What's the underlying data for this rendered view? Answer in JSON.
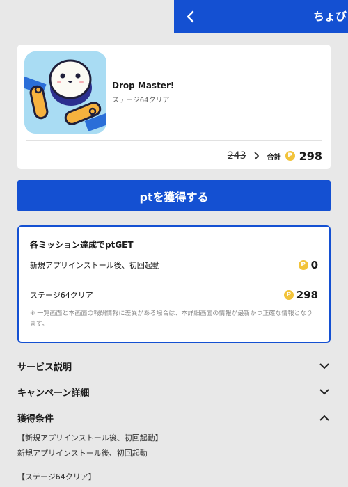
{
  "header": {
    "title": "ちょび",
    "back_icon": "chevron-left-icon",
    "bg_color": "#1450d2"
  },
  "app": {
    "name": "Drop Master!",
    "stage": "ステージ64クリア",
    "old_points": "243",
    "total_label": "合計",
    "coin_symbol": "P",
    "total_points": "298"
  },
  "cta": {
    "label": "ptを獲得する"
  },
  "missions": {
    "title": "各ミッション達成でptGET",
    "items": [
      {
        "label": "新規アプリインストール後、初回起動",
        "points": "0"
      },
      {
        "label": "ステージ64クリア",
        "points": "298"
      }
    ],
    "note": "※ 一覧画面と本画面の報酬情報に差異がある場合は、本詳細画面の情報が最新かつ正確な情報となります。"
  },
  "accordion": [
    {
      "label": "サービス説明",
      "state": "collapsed"
    },
    {
      "label": "キャンペーン詳細",
      "state": "collapsed"
    },
    {
      "label": "獲得条件",
      "state": "expanded"
    }
  ],
  "conditions": {
    "heading_1": "【新規アプリインストール後、初回起動】",
    "text_1": "新規アプリインストール後、初回起動",
    "heading_2": "【ステージ64クリア】"
  },
  "colors": {
    "accent": "#1450d2",
    "coin": "#f2c33a",
    "background": "#e8e8e8"
  }
}
